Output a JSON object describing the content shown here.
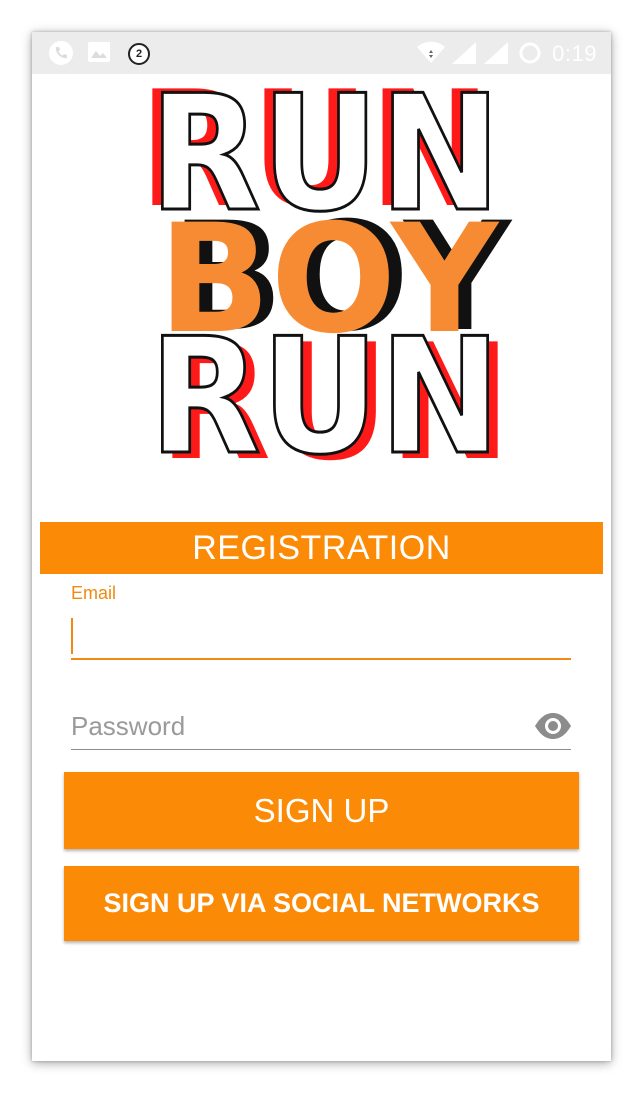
{
  "status_bar": {
    "time": "0:19",
    "notification_count": "2",
    "icons": [
      "phone-icon",
      "image-icon",
      "notification-badge-icon",
      "wifi-icon",
      "signal-icon",
      "signal-icon",
      "loading-icon"
    ]
  },
  "logo": {
    "line1": "RUN",
    "line2": "BOY",
    "line3": "RUN",
    "colors": {
      "shadow_red": "#ff1a1a",
      "accent_orange": "#f78b33",
      "outline_black": "#111111"
    }
  },
  "registration": {
    "title": "REGISTRATION",
    "email_label": "Email",
    "email_value": "",
    "password_placeholder": "Password",
    "password_toggle_icon": "eye-icon",
    "signup_button": "SIGN UP",
    "social_button": "SIGN UP VIA SOCIAL NETWORKS"
  },
  "theme": {
    "primary": "#fb8a06",
    "field_accent": "#f08a12",
    "statusbar_bg": "#ececec"
  }
}
